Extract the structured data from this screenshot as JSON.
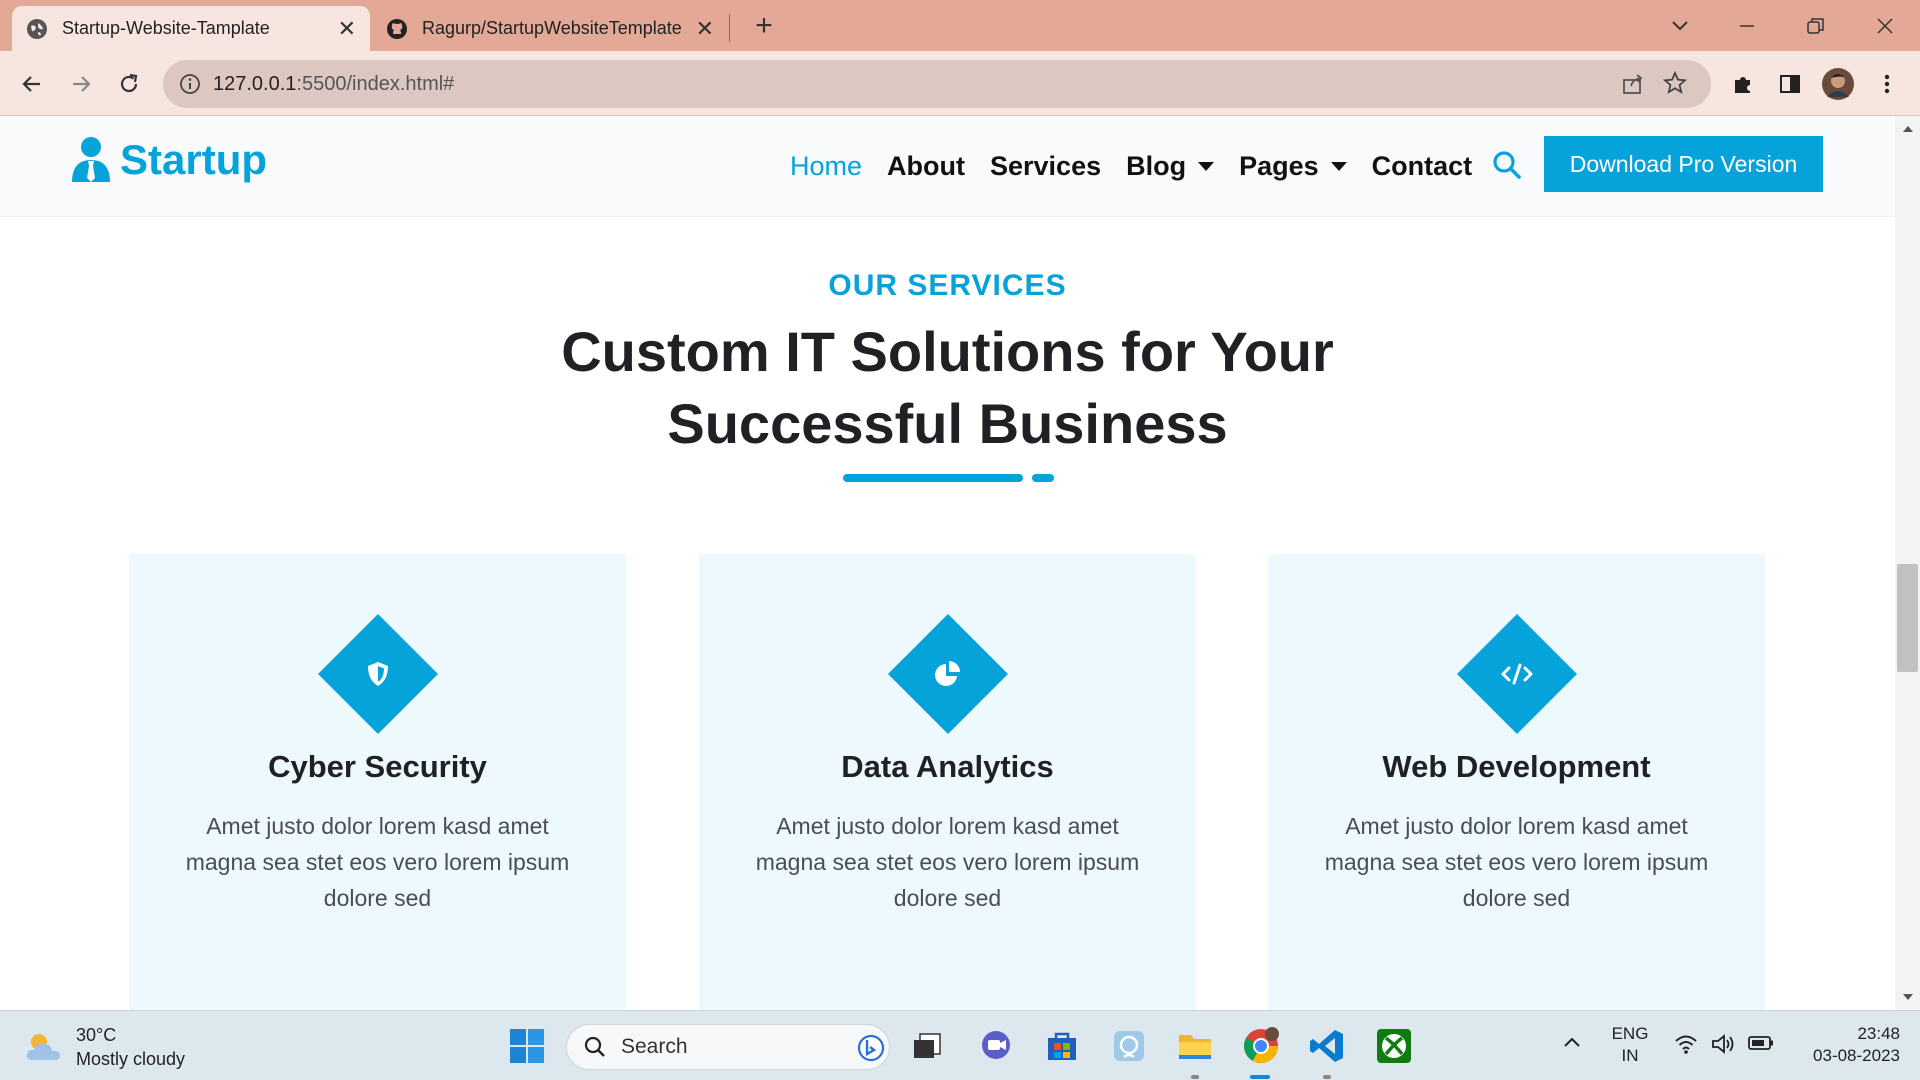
{
  "browser": {
    "tabs": [
      {
        "title": "Startup-Website-Tamplate",
        "active": true
      },
      {
        "title": "Ragurp/StartupWebsiteTemplate",
        "active": false
      }
    ],
    "url": {
      "host": "127.0.0.1",
      "path": ":5500/index.html#"
    }
  },
  "site": {
    "brand": "Startup",
    "nav": [
      {
        "label": "Home",
        "active": true,
        "dropdown": false
      },
      {
        "label": "About",
        "active": false,
        "dropdown": false
      },
      {
        "label": "Services",
        "active": false,
        "dropdown": false
      },
      {
        "label": "Blog",
        "active": false,
        "dropdown": true
      },
      {
        "label": "Pages",
        "active": false,
        "dropdown": true
      },
      {
        "label": "Contact",
        "active": false,
        "dropdown": false
      }
    ],
    "pro_button": "Download Pro Version",
    "section": {
      "eyebrow": "OUR SERVICES",
      "title_line1": "Custom IT Solutions for Your",
      "title_line2": "Successful Business"
    },
    "cards": [
      {
        "title": "Cyber Security",
        "icon": "shield-icon",
        "desc_line1": "Amet justo dolor lorem kasd amet",
        "desc_line2": "magna sea stet eos vero lorem ipsum",
        "desc_line3": "dolore sed"
      },
      {
        "title": "Data Analytics",
        "icon": "pie-chart-icon",
        "desc_line1": "Amet justo dolor lorem kasd amet",
        "desc_line2": "magna sea stet eos vero lorem ipsum",
        "desc_line3": "dolore sed"
      },
      {
        "title": "Web Development",
        "icon": "code-icon",
        "desc_line1": "Amet justo dolor lorem kasd amet",
        "desc_line2": "magna sea stet eos vero lorem ipsum",
        "desc_line3": "dolore sed"
      }
    ],
    "accent": "#06a3da"
  },
  "taskbar": {
    "weather_temp": "30°C",
    "weather_desc": "Mostly cloudy",
    "search_label": "Search",
    "lang_line1": "ENG",
    "lang_line2": "IN",
    "time": "23:48",
    "date": "03-08-2023"
  }
}
